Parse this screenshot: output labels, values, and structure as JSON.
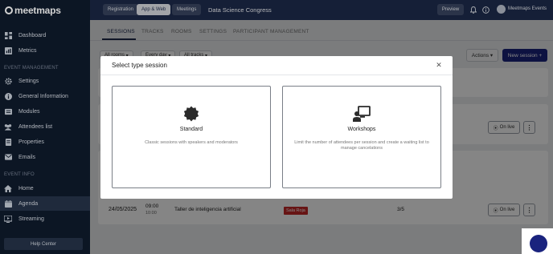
{
  "app": {
    "brand": "meetmaps"
  },
  "sidebar": {
    "top_items": [
      {
        "label": "Dashboard",
        "icon": "dashboard-icon"
      },
      {
        "label": "Metrics",
        "icon": "metrics-icon"
      }
    ],
    "sections": [
      {
        "title": "EVENT MANAGEMENT",
        "items": [
          {
            "label": "Settings",
            "icon": "gear-icon"
          },
          {
            "label": "General Information",
            "icon": "info-icon"
          },
          {
            "label": "Modules",
            "icon": "modules-icon"
          },
          {
            "label": "Attendees list",
            "icon": "attendees-icon"
          },
          {
            "label": "Properties",
            "icon": "properties-icon"
          },
          {
            "label": "Emails",
            "icon": "email-icon"
          }
        ]
      },
      {
        "title": "EVENT INFO",
        "items": [
          {
            "label": "Home",
            "icon": "home-icon"
          },
          {
            "label": "Agenda",
            "icon": "agenda-icon",
            "active": true
          },
          {
            "label": "Streaming",
            "icon": "streaming-icon"
          }
        ]
      }
    ],
    "help_center": "Help Center"
  },
  "topbar": {
    "tabs": [
      {
        "label": "Registration",
        "active": false
      },
      {
        "label": "App & Web",
        "active": true
      },
      {
        "label": "Meetings",
        "active": false
      }
    ],
    "event_title": "Data Science Congress",
    "preview_label": "Preview",
    "user_name": "Meetmaps Events"
  },
  "main": {
    "tabs": [
      "SESSIONS",
      "TRACKS",
      "ROOMS",
      "SETTINGS",
      "PARTICIPANT MANAGEMENT"
    ],
    "filters": [
      "All rooms",
      "Every day",
      "All tracks"
    ],
    "actions_label": "Actions",
    "new_session_label": "New session",
    "row": {
      "date": "24/05/2025",
      "start": "09:00",
      "end": "10:00",
      "title": "Taller de inteligencia artificial",
      "room": "Sala Roja",
      "capacity": "3/5"
    },
    "live_label": "On live"
  },
  "modal": {
    "title": "Select type session",
    "options": [
      {
        "title": "Standard",
        "description": "Classic sessions with speakers and moderators",
        "icon": "badge-icon"
      },
      {
        "title": "Workshops",
        "description": "Limit the number of attendees per session and create a waiting list to manage cancelations",
        "icon": "workshop-icon"
      }
    ]
  },
  "colors": {
    "sidebar_bg": "#0f1b2d",
    "topbar_bg": "#1d2a4a",
    "primary": "#1a237e",
    "room_badge": "#c62828"
  }
}
